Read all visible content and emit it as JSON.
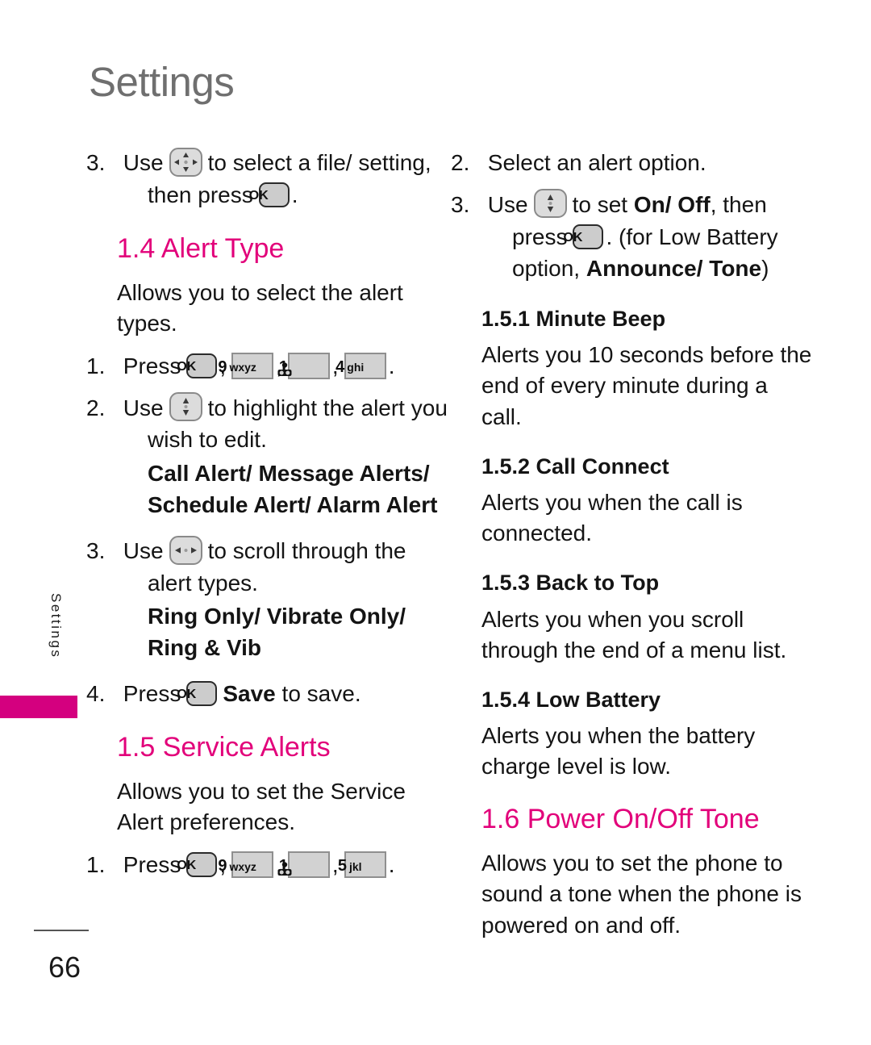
{
  "page": {
    "header": "Settings",
    "side_tab_label": "Settings",
    "side_tab_color": "#d4007f",
    "number": "66",
    "accent_color": "#e2007a",
    "header_color": "#6f6f6f"
  },
  "keys": {
    "ok": "OK",
    "nine": {
      "digit": "9",
      "letters": "wxyz"
    },
    "one": {
      "digit": "1",
      "letters": ""
    },
    "four": {
      "digit": "4",
      "letters": "ghi"
    },
    "five": {
      "digit": "5",
      "letters": "jkl"
    }
  },
  "left_column": {
    "step3_carryover": {
      "num": "3.",
      "text_a": "Use",
      "text_b": "to select a file/",
      "text_c": "setting, then press",
      "text_d": "."
    },
    "section_1_4": {
      "heading": "1.4 Alert Type",
      "intro": "Allows you to select the alert types.",
      "step1": {
        "num": "1.",
        "text": "Press",
        "trailing": "."
      },
      "step2": {
        "num": "2.",
        "text_a": "Use",
        "text_b": "to highlight the alert you wish to edit."
      },
      "step2_options": [
        "Call Alert/ Message Alerts/",
        "Schedule Alert/ Alarm Alert"
      ],
      "step3": {
        "num": "3.",
        "text_a": "Use",
        "text_b": "to scroll through the alert types."
      },
      "step3_options": [
        "Ring Only/ Vibrate Only/",
        "Ring & Vib"
      ],
      "step4": {
        "num": "4.",
        "text_a": "Press",
        "bold": "Save",
        "text_b": "to save."
      }
    },
    "section_1_5": {
      "heading": "1.5 Service Alerts",
      "intro": "Allows you to set the Service Alert preferences.",
      "step1": {
        "num": "1.",
        "text": "Press",
        "trailing": "."
      }
    }
  },
  "right_column": {
    "step2": {
      "num": "2.",
      "text": "Select an alert option."
    },
    "step3": {
      "num": "3.",
      "text_a": "Use",
      "text_b": "to set",
      "bold_a": "On/ Off",
      "text_c": ", then press",
      "text_d": ". (for Low Battery option,",
      "bold_b": "Announce/ Tone",
      "text_e": ")"
    },
    "subsections": [
      {
        "heading": "1.5.1 Minute Beep",
        "body": "Alerts you 10 seconds before the end of every minute during a call."
      },
      {
        "heading": "1.5.2 Call Connect",
        "body": "Alerts you when the call is connected."
      },
      {
        "heading": "1.5.3 Back to Top",
        "body": "Alerts you when you scroll through the end of a menu list."
      },
      {
        "heading": "1.5.4 Low Battery",
        "body": "Alerts you when the battery charge level is low."
      }
    ],
    "section_1_6": {
      "heading": "1.6 Power On/Off Tone",
      "body": "Allows you to set the phone to sound a tone when the phone is powered on and off."
    }
  }
}
